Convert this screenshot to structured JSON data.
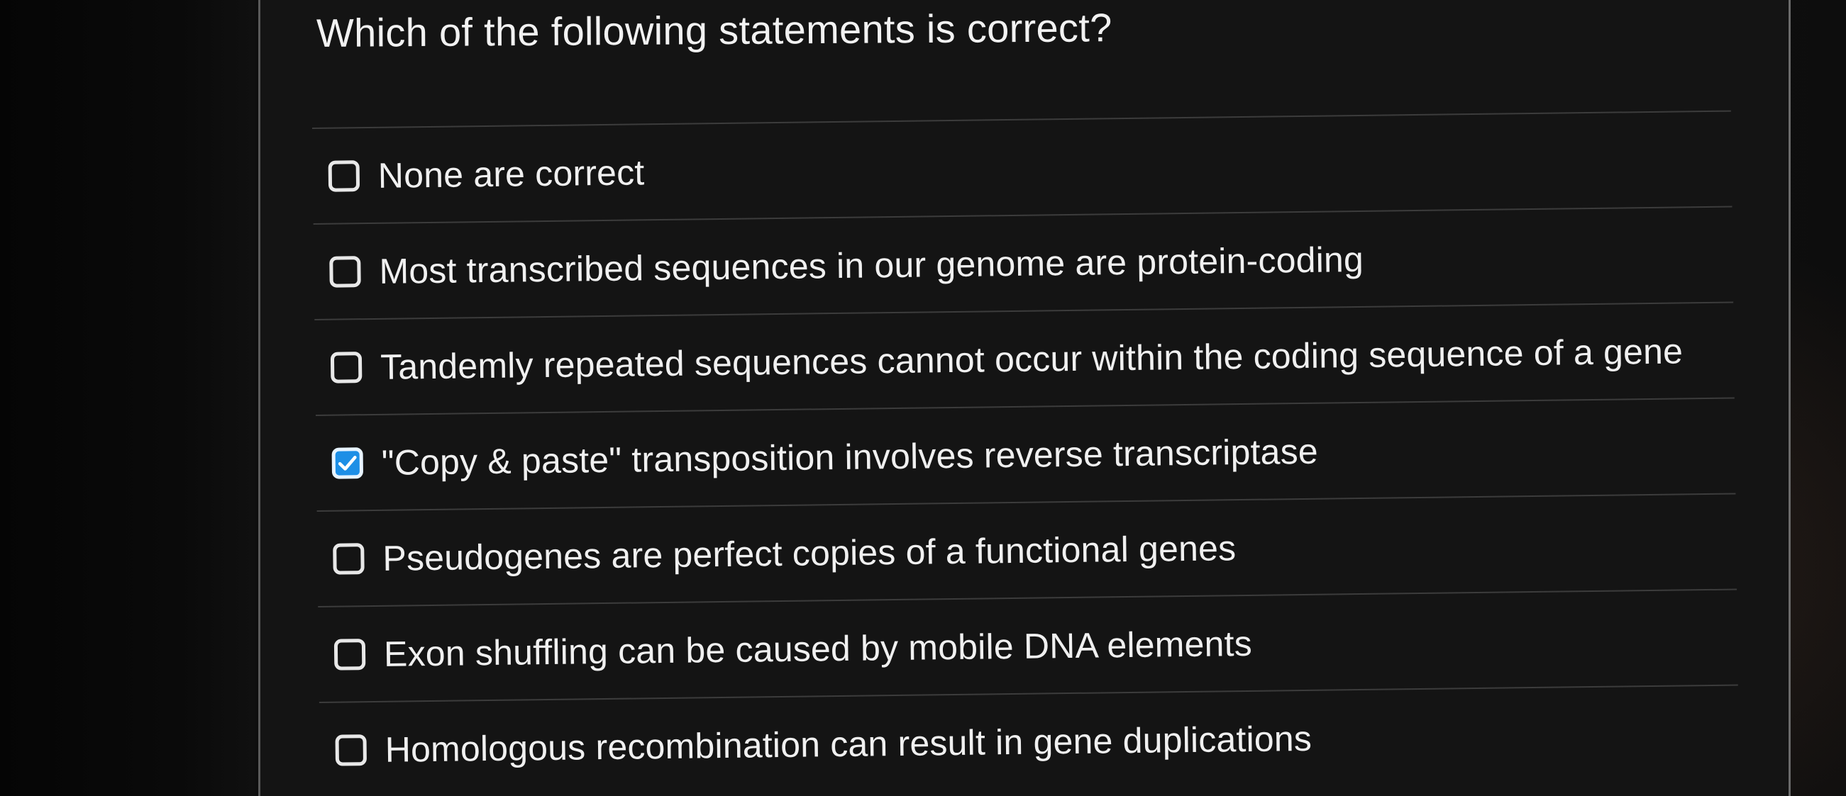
{
  "question": {
    "text": "Which of the following statements is correct?"
  },
  "options": [
    {
      "label": "None are correct",
      "checked": false
    },
    {
      "label": "Most transcribed sequences in our genome are protein-coding",
      "checked": false
    },
    {
      "label": "Tandemly repeated sequences cannot occur within the coding sequence of a gene",
      "checked": false
    },
    {
      "label": "\"Copy & paste\" transposition involves reverse transcriptase",
      "checked": true
    },
    {
      "label": "Pseudogenes are perfect copies of a functional genes",
      "checked": false
    },
    {
      "label": "Exon shuffling can be caused by mobile DNA elements",
      "checked": false
    },
    {
      "label": "Homologous recombination can result in gene duplications",
      "checked": false
    }
  ],
  "colors": {
    "accent": "#1d8fe6",
    "text": "#f0f0f0",
    "background": "#141414"
  },
  "icons": {
    "unchecked": "checkbox-unchecked-icon",
    "checked": "checkbox-checked-icon"
  }
}
